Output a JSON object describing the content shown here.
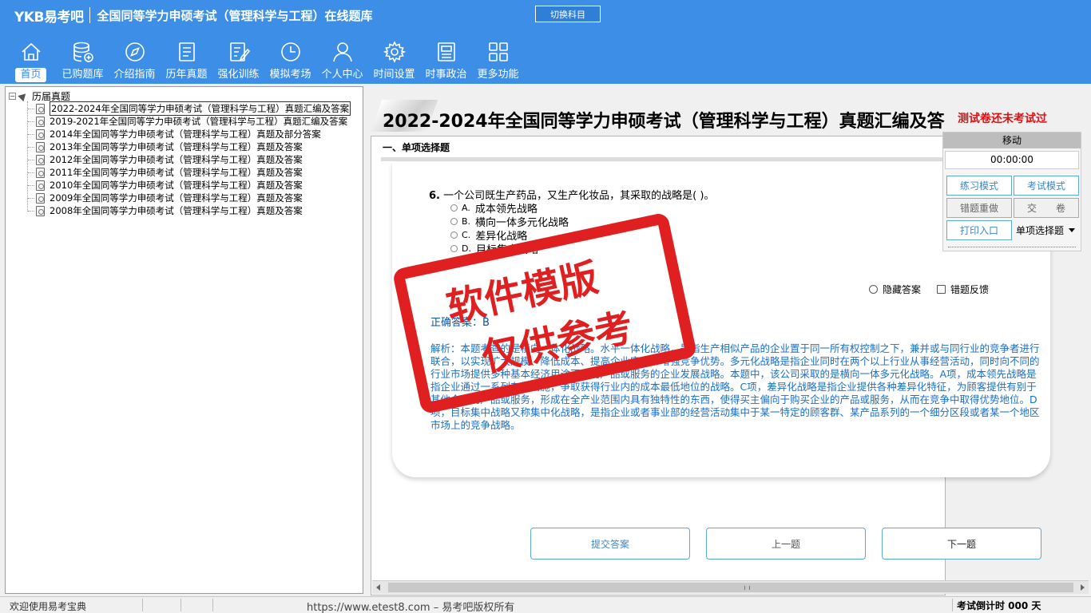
{
  "header": {
    "logo": "YKB易考吧",
    "title": "全国同等学力申硕考试（管理科学与工程）在线题库",
    "switch_subject": "切换科目"
  },
  "nav": {
    "items": [
      {
        "label": "首页",
        "icon": "home-icon",
        "active": true
      },
      {
        "label": "已购题库",
        "icon": "database-icon"
      },
      {
        "label": "介绍指南",
        "icon": "compass-icon"
      },
      {
        "label": "历年真题",
        "icon": "list-doc-icon"
      },
      {
        "label": "强化训练",
        "icon": "edit-doc-icon"
      },
      {
        "label": "模拟考场",
        "icon": "clock-icon"
      },
      {
        "label": "个人中心",
        "icon": "user-icon"
      },
      {
        "label": "时间设置",
        "icon": "gear-icon"
      },
      {
        "label": "时事政治",
        "icon": "newspaper-icon"
      },
      {
        "label": "更多功能",
        "icon": "grid-icon"
      }
    ]
  },
  "tree": {
    "root": "历届真题",
    "items": [
      "2022-2024年全国同等学力申硕考试（管理科学与工程）真题汇编及答案",
      "2019-2021年全国同等学力申硕考试（管理科学与工程）真题汇编及答案",
      "2014年全国同等学力申硕考试（管理科学与工程）真题及部分答案",
      "2013年全国同等学力申硕考试（管理科学与工程）真题及答案",
      "2012年全国同等学力申硕考试（管理科学与工程）真题及答案",
      "2011年全国同等学力申硕考试（管理科学与工程）真题及答案",
      "2010年全国同等学力申硕考试（管理科学与工程）真题及答案",
      "2009年全国同等学力申硕考试（管理科学与工程）真题及答案",
      "2008年全国同等学力申硕考试（管理科学与工程）真题及答案"
    ]
  },
  "main": {
    "doc_title": "2022-2024年全国同等学力申硕考试（管理科学与工程）真题汇编及答",
    "exam_status": "测试卷还未考试过",
    "section": "一、单项选择题",
    "question_number": "6.",
    "question": "一个公司既生产药品，又生产化妆品，其采取的战略是( )。",
    "options": [
      {
        "letter": "A.",
        "text": "成本领先战略"
      },
      {
        "letter": "B.",
        "text": "横向一体多元化战略"
      },
      {
        "letter": "C.",
        "text": "差异化战略"
      },
      {
        "letter": "D.",
        "text": "目标集中战略"
      }
    ],
    "hide_answer": "隐藏答案",
    "feedback": "错题反馈",
    "answer_label": "正确答案：B",
    "analysis": "解析：本题考查的是横向一体化战略。水平一体化战略，是指生产相似产品的企业置于同一所有权控制之下，兼并或与同行业的竞争者进行联合，以实现扩大规模、降低成本、提高企业实力、增强竞争优势。多元化战略是指企业同时在两个以上行业从事经营活动，同时向不同的行业市场提供多种基本经济用途不同的产品或服务的企业发展战略。本题中，该公司采取的是横向一体多元化战略。A项，成本领先战略是指企业通过一系列有效措施，争取获得行业内的成本最低地位的战略。C项，差异化战略是指企业提供各种差异化特征，为顾客提供有别于其他企业的产品或服务，形成在全产业范围内具有独特性的东西，使得买主偏向于购买企业的产品或服务，从而在竞争中取得优势地位。D项，目标集中战略又称集中化战略，是指企业或者事业部的经营活动集中于某一特定的顾客群、某产品系列的一个细分区段或者某一个地区市场上的竞争战略。",
    "buttons": {
      "submit": "提交答案",
      "prev": "上一题",
      "next": "下一题"
    }
  },
  "side_panel": {
    "move": "移动",
    "timer": "00:00:00",
    "practice_mode": "练习模式",
    "exam_mode": "考试模式",
    "redo_wrong": "错题重做",
    "hand_in": "交　　卷",
    "print": "打印入口",
    "question_type": "单项选择题"
  },
  "stamp": {
    "line1": "软件模版",
    "line2": "仅供参考"
  },
  "status_bar": {
    "welcome": "欢迎使用易考宝典",
    "copyright": "https://www.etest8.com – 易考吧版权所有",
    "countdown": "考试倒计时 000 天"
  },
  "colors": {
    "header_bg": "#3d8ee6",
    "stamp_red": "#e02020",
    "analysis_blue": "#1a6fc8",
    "button_border": "#5aa9d9"
  }
}
